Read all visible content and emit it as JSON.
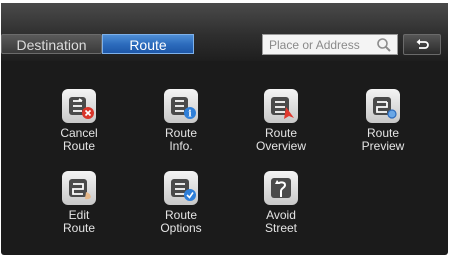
{
  "tabs": [
    {
      "label": "Destination",
      "active": false
    },
    {
      "label": "Route",
      "active": true
    }
  ],
  "search": {
    "placeholder": "Place or Address"
  },
  "menu": [
    {
      "label": "Cancel\nRoute",
      "icon": "cancel-route-icon"
    },
    {
      "label": "Route\nInfo.",
      "icon": "route-info-icon"
    },
    {
      "label": "Route\nOverview",
      "icon": "route-overview-icon"
    },
    {
      "label": "Route\nPreview",
      "icon": "route-preview-icon"
    },
    {
      "label": "Edit\nRoute",
      "icon": "edit-route-icon"
    },
    {
      "label": "Route\nOptions",
      "icon": "route-options-icon"
    },
    {
      "label": "Avoid\nStreet",
      "icon": "avoid-street-icon"
    }
  ],
  "colors": {
    "accent": "#2d6cbd",
    "cancel_badge": "#d9362b",
    "info_badge": "#2f7fd8",
    "overview_arrow": "#e03a2f"
  }
}
